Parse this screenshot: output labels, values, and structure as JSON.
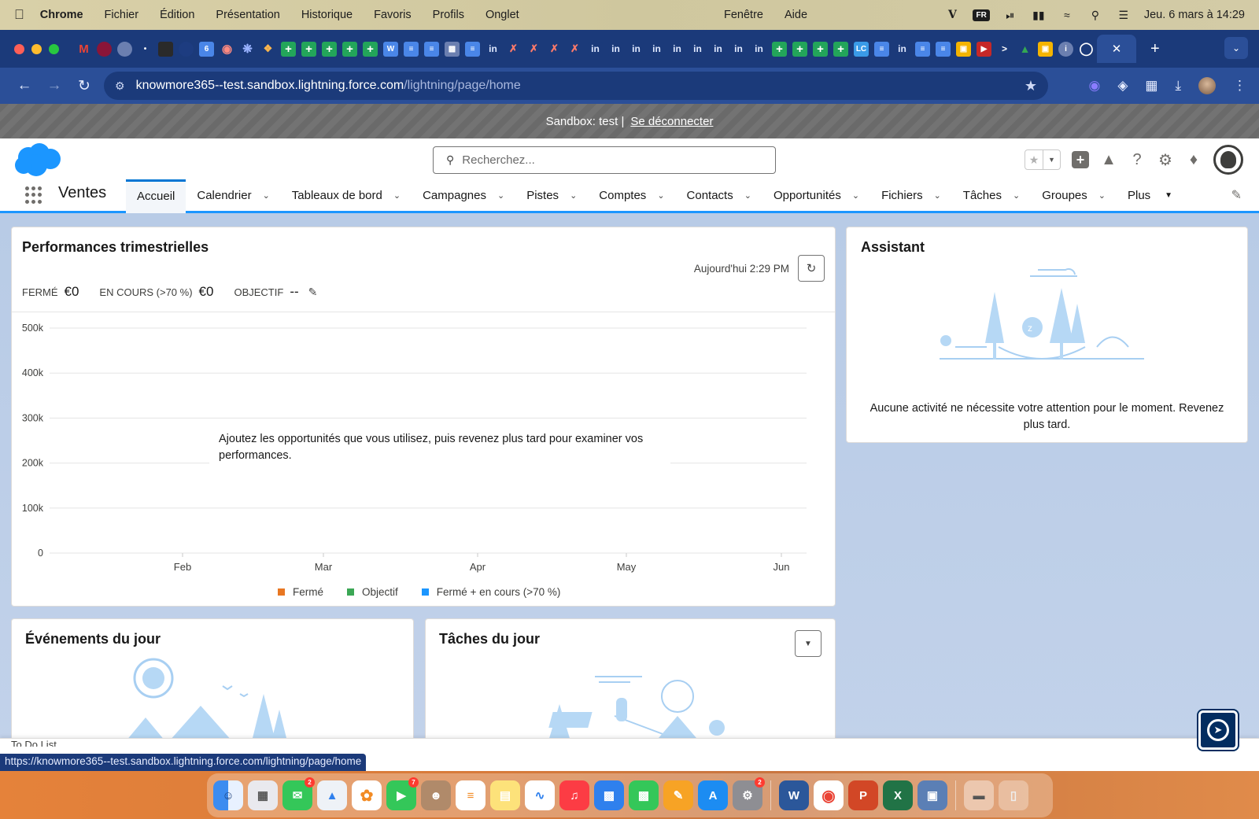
{
  "menubar": {
    "app": "Chrome",
    "items": [
      "Fichier",
      "Édition",
      "Présentation",
      "Historique",
      "Favoris",
      "Profils",
      "Onglet"
    ],
    "center_items": [
      "Fenêtre",
      "Aide"
    ],
    "input_source": "FR",
    "clock": "Jeu. 6 mars à 14:29"
  },
  "browser": {
    "url_host": "knowmore365--test.sandbox.lightning.force.com",
    "url_path": "/lightning/page/home",
    "status_url": "https://knowmore365--test.sandbox.lightning.force.com/lightning/page/home"
  },
  "sandbox": {
    "label": "Sandbox: test |",
    "logout": "Se déconnecter"
  },
  "header": {
    "search_placeholder": "Recherchez...",
    "app_name": "Ventes"
  },
  "nav": {
    "items": [
      {
        "label": "Accueil",
        "dropdown": false
      },
      {
        "label": "Calendrier",
        "dropdown": true
      },
      {
        "label": "Tableaux de bord",
        "dropdown": true
      },
      {
        "label": "Campagnes",
        "dropdown": true
      },
      {
        "label": "Pistes",
        "dropdown": true
      },
      {
        "label": "Comptes",
        "dropdown": true
      },
      {
        "label": "Contacts",
        "dropdown": true
      },
      {
        "label": "Opportunités",
        "dropdown": true
      },
      {
        "label": "Fichiers",
        "dropdown": true
      },
      {
        "label": "Tâches",
        "dropdown": true
      },
      {
        "label": "Groupes",
        "dropdown": true
      }
    ],
    "more": "Plus"
  },
  "performance": {
    "title": "Performances trimestrielles",
    "as_of": "Aujourd'hui 2:29 PM",
    "closed_label": "FERMÉ",
    "closed_value": "€0",
    "open_label": "EN COURS (>70 %)",
    "open_value": "€0",
    "goal_label": "OBJECTIF",
    "goal_value": "--",
    "empty_message": "Ajoutez les opportunités que vous utilisez, puis revenez plus tard pour examiner vos performances."
  },
  "chart_data": {
    "type": "line",
    "x": [
      "Feb",
      "Mar",
      "Apr",
      "May",
      "Jun"
    ],
    "y_ticks": [
      "0",
      "100k",
      "200k",
      "300k",
      "400k",
      "500k"
    ],
    "ylim": [
      0,
      500000
    ],
    "grid": true,
    "legend_position": "bottom",
    "series": [
      {
        "name": "Fermé",
        "color": "#e87722",
        "values": []
      },
      {
        "name": "Objectif",
        "color": "#3ba755",
        "values": []
      },
      {
        "name": "Fermé + en cours (>70 %)",
        "color": "#1b96ff",
        "values": []
      }
    ]
  },
  "assistant": {
    "title": "Assistant",
    "message": "Aucune activité ne nécessite votre attention pour le moment. Revenez plus tard."
  },
  "events": {
    "title": "Événements du jour"
  },
  "tasks": {
    "title": "Tâches du jour"
  },
  "utility": {
    "todo": "To Do List"
  },
  "dock": {
    "badges": {
      "messages": "2",
      "facetime": "7",
      "settings": "2"
    }
  }
}
